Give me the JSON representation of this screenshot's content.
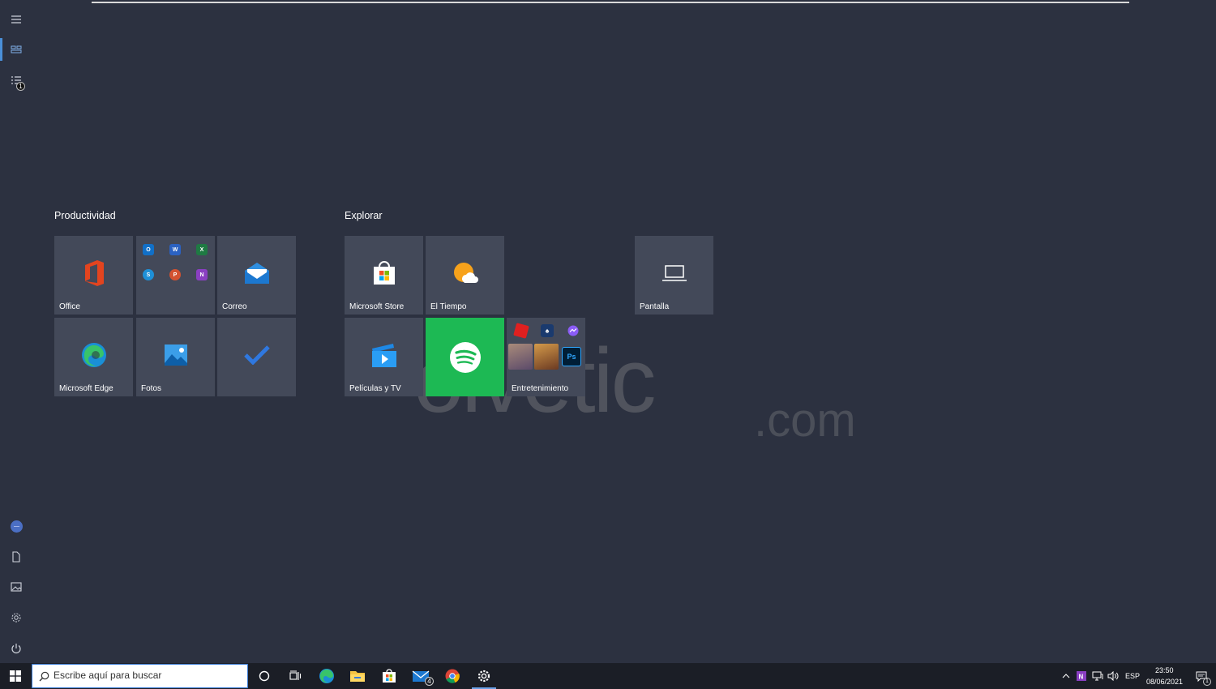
{
  "groups": [
    {
      "title": "Productividad"
    },
    {
      "title": "Explorar"
    }
  ],
  "tiles": {
    "office": "Office",
    "correo": "Correo",
    "edge": "Microsoft Edge",
    "fotos": "Fotos",
    "store": "Microsoft Store",
    "tiempo": "El Tiempo",
    "peliculas": "Películas y TV",
    "entretenimiento": "Entretenimiento",
    "pantalla": "Pantalla"
  },
  "office_apps": [
    "O",
    "W",
    "X",
    "S",
    "P",
    "N"
  ],
  "entertainment_apps": [
    "Ps"
  ],
  "rail": {
    "notification_count": "1"
  },
  "search": {
    "placeholder": "Escribe aquí para buscar"
  },
  "taskbar": {
    "mail_badge": "4",
    "language": "ESP",
    "time": "23:50",
    "date": "08/06/2021",
    "notification_count": "1"
  },
  "watermark": {
    "main": "olvetic",
    "suffix": ".com"
  },
  "colors": {
    "background": "#2c3140",
    "tile": "#434959",
    "spotify": "#1db954",
    "taskbar": "#1b1e26",
    "accent": "#4a8fd8"
  },
  "icons": {
    "rail": [
      "hamburger-icon",
      "tiles-icon",
      "list-icon",
      "avatar",
      "document-icon",
      "pictures-icon",
      "gear-icon",
      "power-icon"
    ],
    "taskbar": [
      "windows-icon",
      "search-icon",
      "cortana-icon",
      "task-view-icon",
      "edge-icon",
      "explorer-icon",
      "store-icon",
      "mail-icon",
      "chrome-icon",
      "settings-icon"
    ]
  }
}
